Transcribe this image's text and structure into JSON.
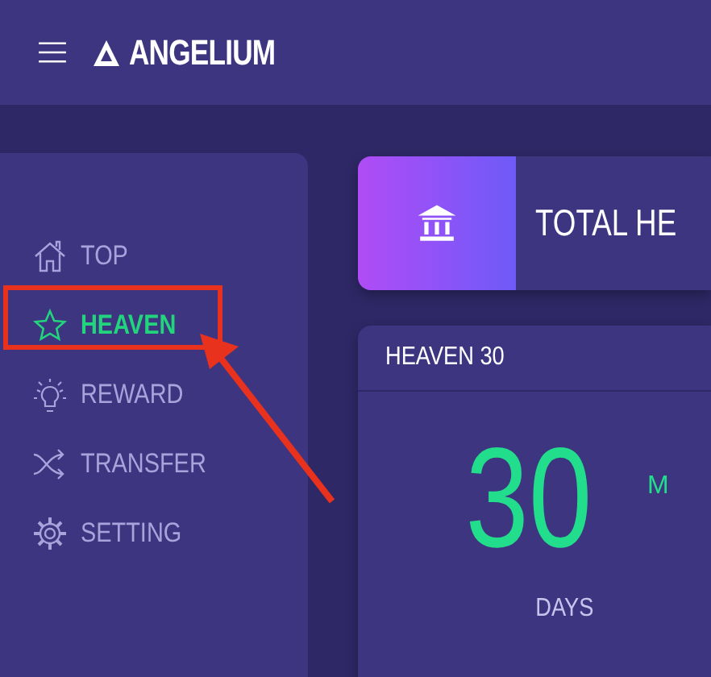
{
  "header": {
    "brand": "ANGELIUM"
  },
  "sidebar": {
    "items": [
      {
        "label": "TOP",
        "kind": "house",
        "selected": false
      },
      {
        "label": "HEAVEN",
        "kind": "star",
        "selected": true
      },
      {
        "label": "REWARD",
        "kind": "bulb",
        "selected": false
      },
      {
        "label": "TRANSFER",
        "kind": "shuffle",
        "selected": false
      },
      {
        "label": "SETTING",
        "kind": "gear",
        "selected": false
      }
    ]
  },
  "total_card": {
    "title": "TOTAL HE"
  },
  "plan_card": {
    "title": "HEAVEN 30",
    "value": "30",
    "unit": "DAYS",
    "column_2": "M"
  }
}
